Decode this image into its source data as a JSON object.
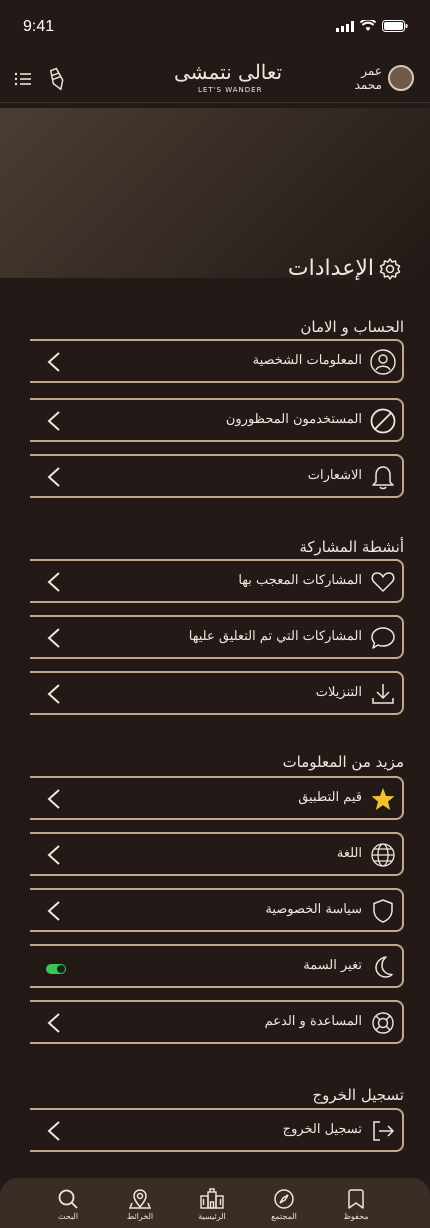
{
  "status": {
    "time": "9:41"
  },
  "header": {
    "logo_text": "تعالى نتمشى",
    "logo_sub": "LET'S WANDER",
    "user_first": "عمر",
    "user_last": "محمد"
  },
  "page": {
    "title": "الإعدادات"
  },
  "sections": {
    "account": {
      "title": "الحساب و الامان",
      "items": [
        "المعلومات الشخصية",
        "المستخدمون المحظورون",
        "الاشعارات"
      ]
    },
    "activity": {
      "title": "أنشطة المشاركة",
      "items": [
        "المشاركات المعجب بها",
        "المشاركات التي تم التعليق عليها",
        "التنزيلات"
      ]
    },
    "more": {
      "title": "مزيد من المعلومات",
      "items": [
        "قيم التطبيق",
        "اللغة",
        "سياسة الخصوصية",
        "تغير السمة",
        "المساعدة و الدعم"
      ]
    },
    "logout": {
      "title": "تسجيل الخروج",
      "items": [
        "تسجيل الخروج"
      ]
    }
  },
  "nav": [
    "البحث",
    "الخرائط",
    "الرئيسية",
    "المجتمع",
    "محفوظ"
  ],
  "colors": {
    "accent": "#bfa88c",
    "background": "#231a17",
    "star": "#f2c12e",
    "toggle": "#3ac65a"
  }
}
